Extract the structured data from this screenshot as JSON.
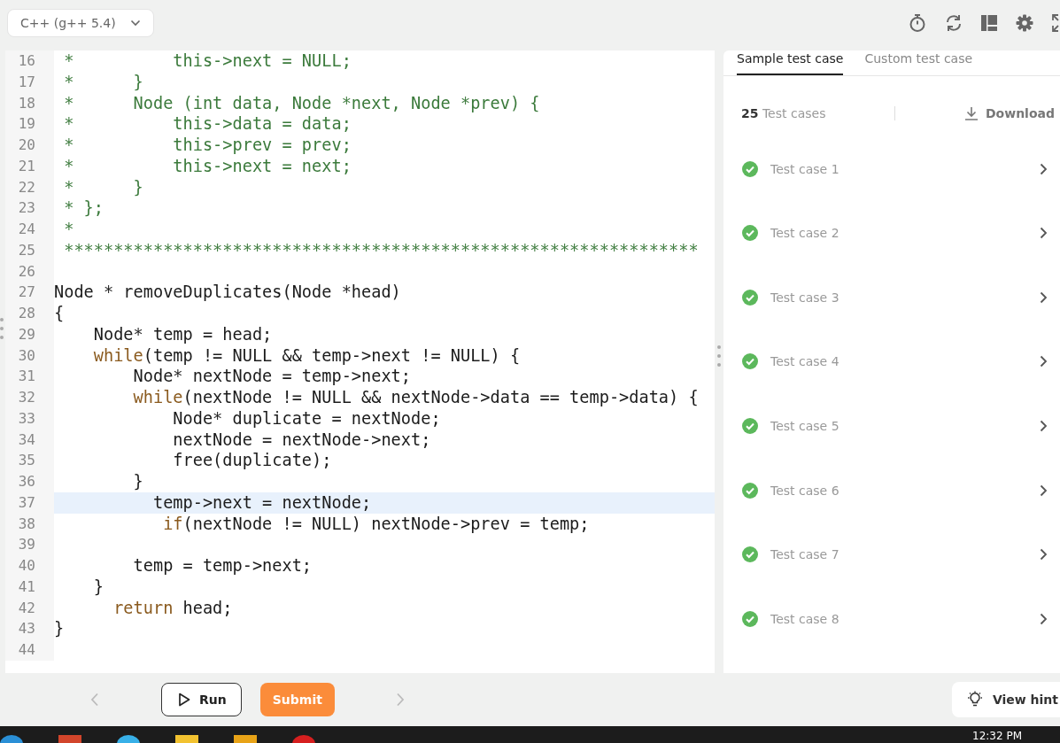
{
  "language_select": {
    "value": "C++ (g++ 5.4)"
  },
  "editor": {
    "lines": [
      {
        "number": "16",
        "current": false,
        "tokens": [
          {
            "text": " *          this->next = NULL;",
            "kind": "comment"
          }
        ]
      },
      {
        "number": "17",
        "current": false,
        "tokens": [
          {
            "text": " *      }",
            "kind": "comment"
          }
        ]
      },
      {
        "number": "18",
        "current": false,
        "tokens": [
          {
            "text": " *      Node (int data, Node *next, Node *prev) {",
            "kind": "comment"
          }
        ]
      },
      {
        "number": "19",
        "current": false,
        "tokens": [
          {
            "text": " *          this->data = data;",
            "kind": "comment"
          }
        ]
      },
      {
        "number": "20",
        "current": false,
        "tokens": [
          {
            "text": " *          this->prev = prev;",
            "kind": "comment"
          }
        ]
      },
      {
        "number": "21",
        "current": false,
        "tokens": [
          {
            "text": " *          this->next = next;",
            "kind": "comment"
          }
        ]
      },
      {
        "number": "22",
        "current": false,
        "tokens": [
          {
            "text": " *      }",
            "kind": "comment"
          }
        ]
      },
      {
        "number": "23",
        "current": false,
        "tokens": [
          {
            "text": " * };",
            "kind": "comment"
          }
        ]
      },
      {
        "number": "24",
        "current": false,
        "tokens": [
          {
            "text": " *",
            "kind": "comment"
          }
        ]
      },
      {
        "number": "25",
        "current": false,
        "tokens": [
          {
            "text": " ****************************************************************",
            "kind": "comment"
          }
        ]
      },
      {
        "number": "26",
        "current": false
      },
      {
        "number": "27",
        "current": false,
        "tokens": [
          {
            "text": "Node * removeDuplicates(Node *head)",
            "kind": "plain"
          }
        ]
      },
      {
        "number": "28",
        "current": false,
        "tokens": [
          {
            "text": "{",
            "kind": "plain"
          }
        ]
      },
      {
        "number": "29",
        "current": false,
        "tokens": [
          {
            "text": "    Node* temp = head;",
            "kind": "plain"
          }
        ]
      },
      {
        "number": "30",
        "current": false,
        "tokens": [
          {
            "text": "    while",
            "kind": "keyword"
          },
          {
            "text": "(temp != NULL && temp->next != NULL) {",
            "kind": "plain"
          }
        ]
      },
      {
        "number": "31",
        "current": false,
        "tokens": [
          {
            "text": "        Node* nextNode = temp->next;",
            "kind": "plain"
          }
        ]
      },
      {
        "number": "32",
        "current": false,
        "tokens": [
          {
            "text": "        while",
            "kind": "keyword"
          },
          {
            "text": "(nextNode != NULL && nextNode->data == temp->data) {",
            "kind": "plain"
          }
        ]
      },
      {
        "number": "33",
        "current": false,
        "tokens": [
          {
            "text": "            Node* duplicate = nextNode;",
            "kind": "plain"
          }
        ]
      },
      {
        "number": "34",
        "current": false,
        "tokens": [
          {
            "text": "            nextNode = nextNode->next;",
            "kind": "plain"
          }
        ]
      },
      {
        "number": "35",
        "current": false,
        "tokens": [
          {
            "text": "            free(duplicate);",
            "kind": "plain"
          }
        ]
      },
      {
        "number": "36",
        "current": false,
        "tokens": [
          {
            "text": "        }",
            "kind": "plain"
          }
        ]
      },
      {
        "number": "37",
        "current": true,
        "tokens": [
          {
            "text": "          temp->next = nextNode;",
            "kind": "plain"
          }
        ]
      },
      {
        "number": "38",
        "current": false,
        "tokens": [
          {
            "text": "           if",
            "kind": "keyword"
          },
          {
            "text": "(nextNode != NULL) nextNode->prev = temp;",
            "kind": "plain"
          }
        ]
      },
      {
        "number": "39",
        "current": false
      },
      {
        "number": "40",
        "current": false,
        "tokens": [
          {
            "text": "        temp = temp->next;",
            "kind": "plain"
          }
        ]
      },
      {
        "number": "41",
        "current": false,
        "tokens": [
          {
            "text": "    }",
            "kind": "plain"
          }
        ]
      },
      {
        "number": "42",
        "current": false,
        "tokens": [
          {
            "text": "      return",
            "kind": "keyword"
          },
          {
            "text": " head;",
            "kind": "plain"
          }
        ]
      },
      {
        "number": "43",
        "current": false,
        "tokens": [
          {
            "text": "}",
            "kind": "plain"
          }
        ]
      },
      {
        "number": "44",
        "current": false
      }
    ]
  },
  "tests": {
    "tabs": [
      {
        "label": "Sample test case",
        "selected": true
      },
      {
        "label": "Custom test case",
        "selected": false
      }
    ],
    "count": "**25** Test cases",
    "download": "Download",
    "cases": [
      {
        "label": "Test case 1",
        "passed": true
      },
      {
        "label": "Test case 2",
        "passed": true
      },
      {
        "label": "Test case 3",
        "passed": true
      },
      {
        "label": "Test case 4",
        "passed": true
      },
      {
        "label": "Test case 5",
        "passed": true
      },
      {
        "label": "Test case 6",
        "passed": true
      },
      {
        "label": "Test case 7",
        "passed": true
      },
      {
        "label": "Test case 8",
        "passed": true
      }
    ]
  },
  "footer": {
    "run": "Run",
    "submit": "Submit",
    "hints": "View hint"
  },
  "taskbar": {
    "time": "12:32 PM"
  }
}
